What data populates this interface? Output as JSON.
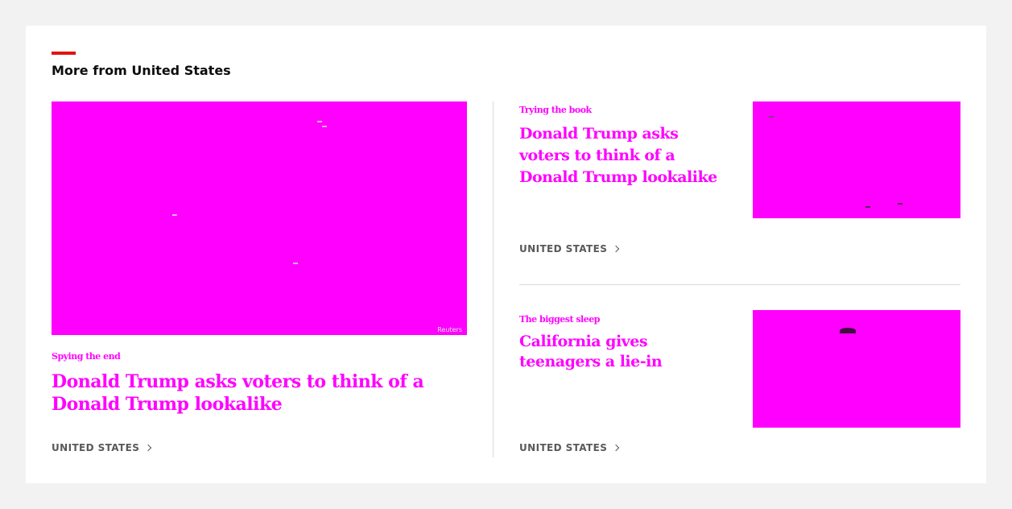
{
  "section": {
    "title": "More from United States"
  },
  "colors": {
    "accent": "#e3120b",
    "placeholder_image": "#ff00ff",
    "panel_background": "#ffffff",
    "page_background": "#f2f2f2"
  },
  "articles": [
    {
      "rubric": "Spying the end",
      "headline": "Donald Trump asks voters to think of a Donald Trump lookalike",
      "section_link": "UNITED STATES",
      "image_credit": "Reuters"
    },
    {
      "rubric": "Trying the book",
      "headline": "Donald Trump asks voters to think of a Donald Trump lookalike",
      "section_link": "UNITED STATES"
    },
    {
      "rubric": "The biggest sleep",
      "headline": "California gives teenagers a lie-in",
      "section_link": "UNITED STATES"
    }
  ]
}
